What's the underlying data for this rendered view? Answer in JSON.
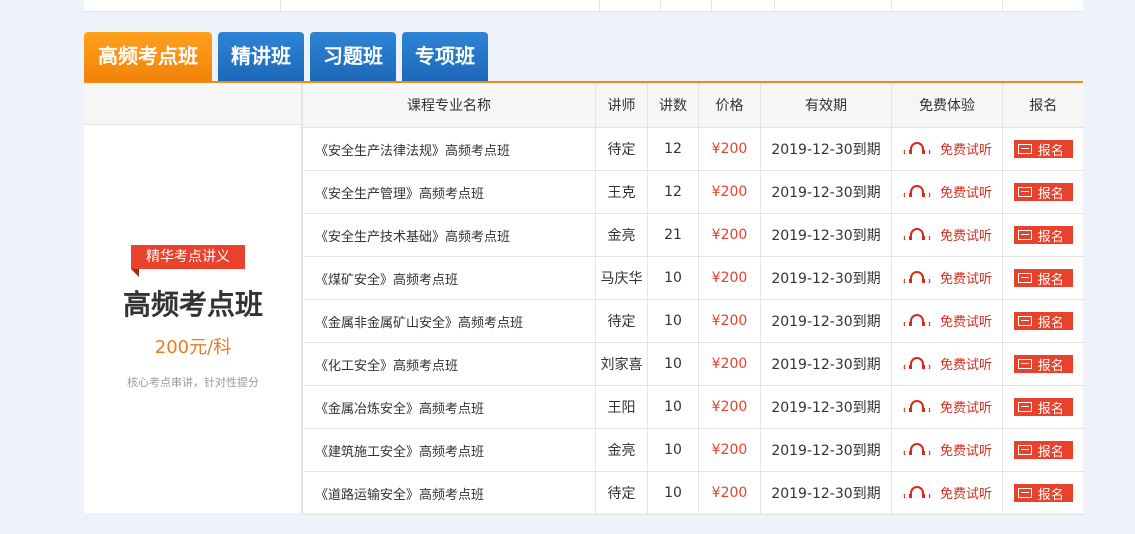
{
  "tabs": [
    {
      "label": "高频考点班",
      "active": true
    },
    {
      "label": "精讲班",
      "active": false
    },
    {
      "label": "习题班",
      "active": false
    },
    {
      "label": "专项班",
      "active": false
    }
  ],
  "side": {
    "ribbon": "精华考点讲义",
    "title": "高频考点班",
    "price": "200元/科",
    "desc": "核心考点串讲，针对性提分"
  },
  "table": {
    "headers": [
      "课程专业名称",
      "讲师",
      "讲数",
      "价格",
      "有效期",
      "免费体验",
      "报名"
    ],
    "trial_label": "免费试听",
    "signup_label": "报名",
    "rows": [
      {
        "name": "《安全生产法律法规》高频考点班",
        "teacher": "待定",
        "lessons": "12",
        "price": "¥200",
        "validity": "2019-12-30到期"
      },
      {
        "name": "《安全生产管理》高频考点班",
        "teacher": "王克",
        "lessons": "12",
        "price": "¥200",
        "validity": "2019-12-30到期"
      },
      {
        "name": "《安全生产技术基础》高频考点班",
        "teacher": "金亮",
        "lessons": "21",
        "price": "¥200",
        "validity": "2019-12-30到期"
      },
      {
        "name": "《煤矿安全》高频考点班",
        "teacher": "马庆华",
        "lessons": "10",
        "price": "¥200",
        "validity": "2019-12-30到期"
      },
      {
        "name": "《金属非金属矿山安全》高频考点班",
        "teacher": "待定",
        "lessons": "10",
        "price": "¥200",
        "validity": "2019-12-30到期"
      },
      {
        "name": "《化工安全》高频考点班",
        "teacher": "刘家喜",
        "lessons": "10",
        "price": "¥200",
        "validity": "2019-12-30到期"
      },
      {
        "name": "《金属冶炼安全》高频考点班",
        "teacher": "王阳",
        "lessons": "10",
        "price": "¥200",
        "validity": "2019-12-30到期"
      },
      {
        "name": "《建筑施工安全》高频考点班",
        "teacher": "金亮",
        "lessons": "10",
        "price": "¥200",
        "validity": "2019-12-30到期"
      },
      {
        "name": "《道路运输安全》高频考点班",
        "teacher": "待定",
        "lessons": "10",
        "price": "¥200",
        "validity": "2019-12-30到期"
      }
    ]
  },
  "colors": {
    "tab_active": "#f39414",
    "tab": "#2879c8",
    "accent_red": "#e8412c",
    "price_orange": "#f07b1b"
  }
}
